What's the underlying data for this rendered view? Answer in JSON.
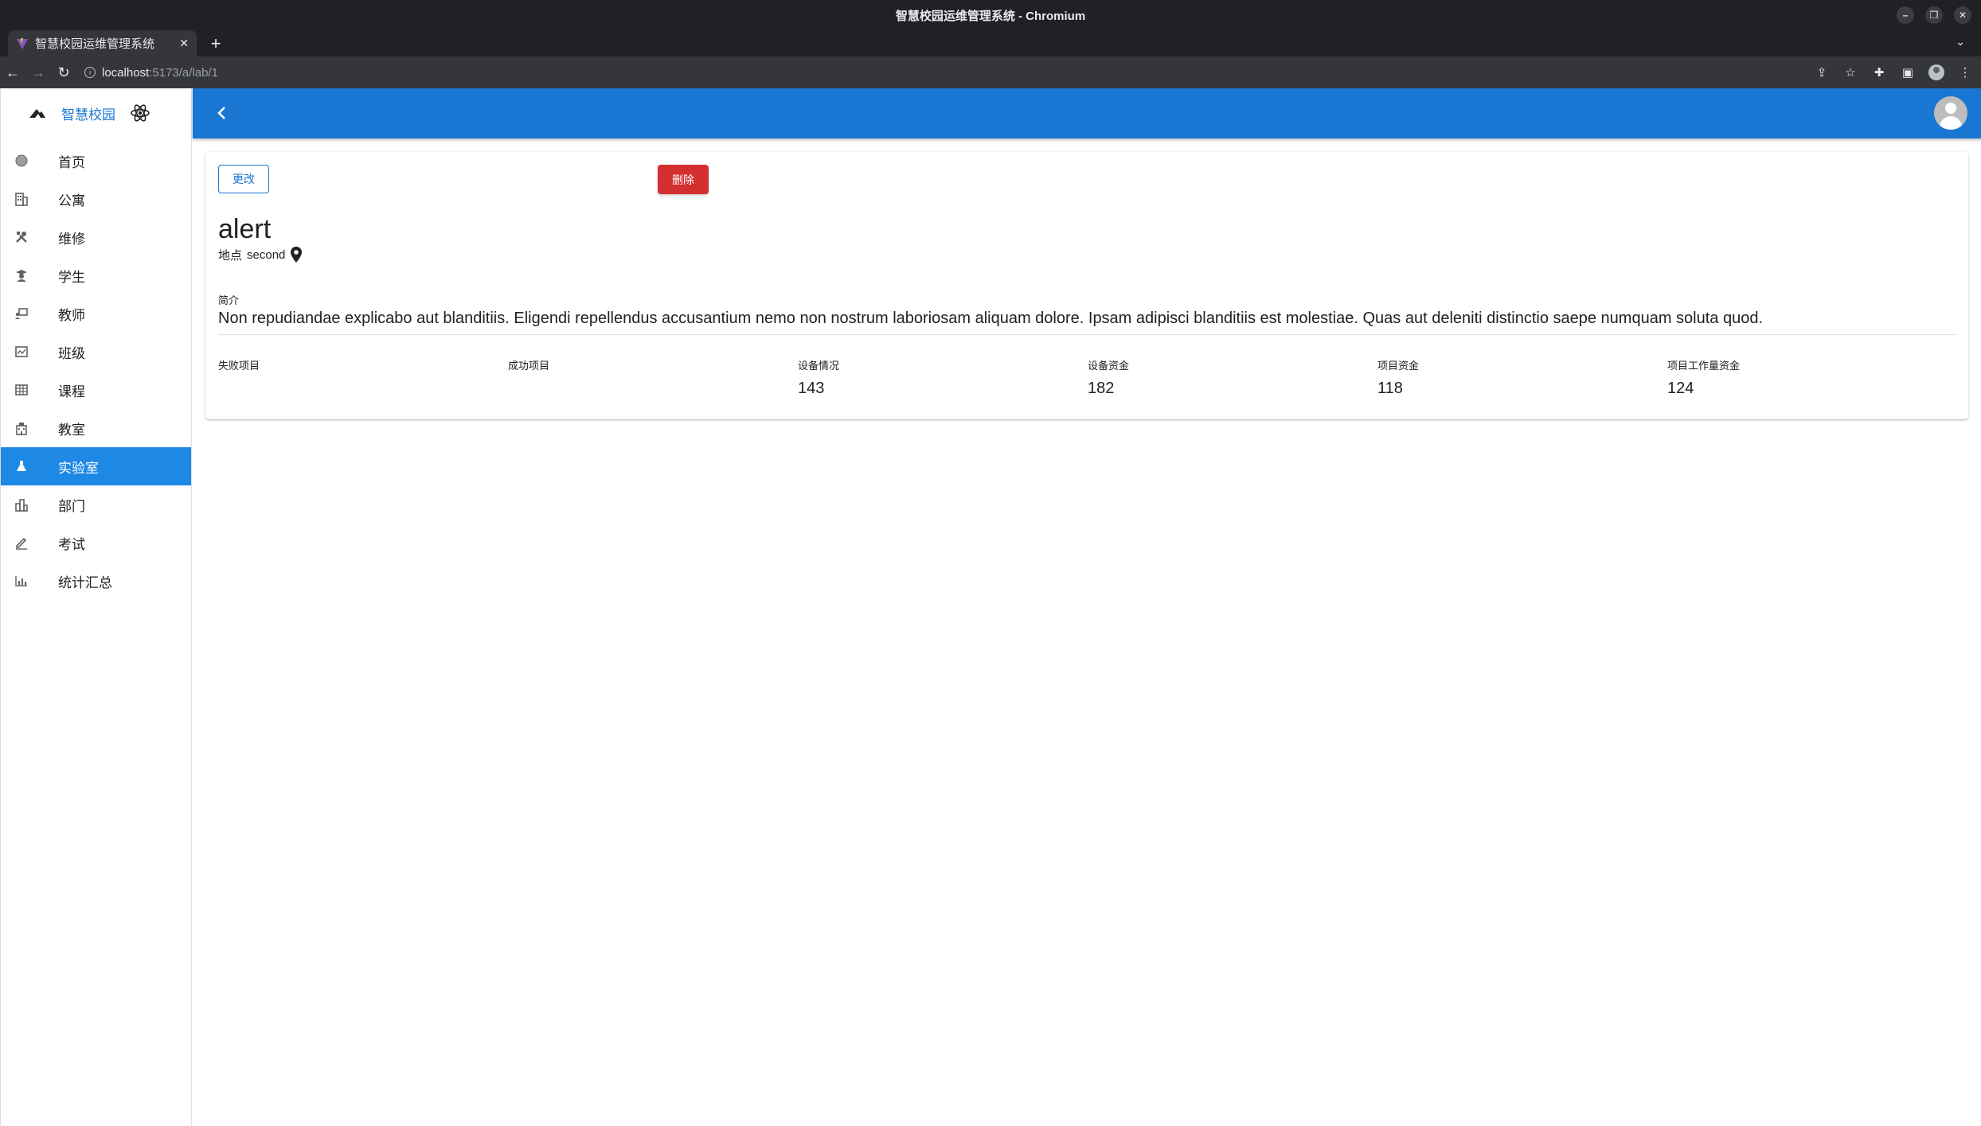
{
  "window": {
    "title": "智慧校园运维管理系统 - Chromium"
  },
  "tab": {
    "title": "智慧校园运维管理系统"
  },
  "address": {
    "host": "localhost",
    "path": ":5173/a/lab/1"
  },
  "brand": {
    "name": "智慧校园"
  },
  "sidebar": {
    "items": [
      {
        "label": "首页",
        "icon": "home-circle-icon"
      },
      {
        "label": "公寓",
        "icon": "apartment-icon"
      },
      {
        "label": "维修",
        "icon": "tools-icon"
      },
      {
        "label": "学生",
        "icon": "student-icon"
      },
      {
        "label": "教师",
        "icon": "teacher-icon"
      },
      {
        "label": "班级",
        "icon": "class-icon"
      },
      {
        "label": "课程",
        "icon": "course-table-icon"
      },
      {
        "label": "教室",
        "icon": "classroom-icon"
      },
      {
        "label": "实验室",
        "icon": "flask-icon",
        "active": true
      },
      {
        "label": "部门",
        "icon": "department-icon"
      },
      {
        "label": "考试",
        "icon": "exam-pen-icon"
      },
      {
        "label": "统计汇总",
        "icon": "stats-chart-icon"
      }
    ]
  },
  "actions": {
    "edit": "更改",
    "delete": "删除"
  },
  "lab": {
    "name": "alert",
    "location_label": "地点",
    "location": "second",
    "intro_label": "简介",
    "intro": "Non repudiandae explicabo aut blanditiis. Eligendi repellendus accusantium nemo non nostrum laboriosam aliquam dolore. Ipsam adipisci blanditiis est molestiae. Quas aut deleniti distinctio saepe numquam soluta quod."
  },
  "stats": [
    {
      "label": "失败项目",
      "value": ""
    },
    {
      "label": "成功项目",
      "value": ""
    },
    {
      "label": "设备情况",
      "value": "143"
    },
    {
      "label": "设备资金",
      "value": "182"
    },
    {
      "label": "项目资金",
      "value": "118"
    },
    {
      "label": "项目工作量资金",
      "value": "124"
    }
  ],
  "colors": {
    "primary": "#1976d2",
    "active_nav": "#1e88e5",
    "danger": "#d32f2f"
  }
}
